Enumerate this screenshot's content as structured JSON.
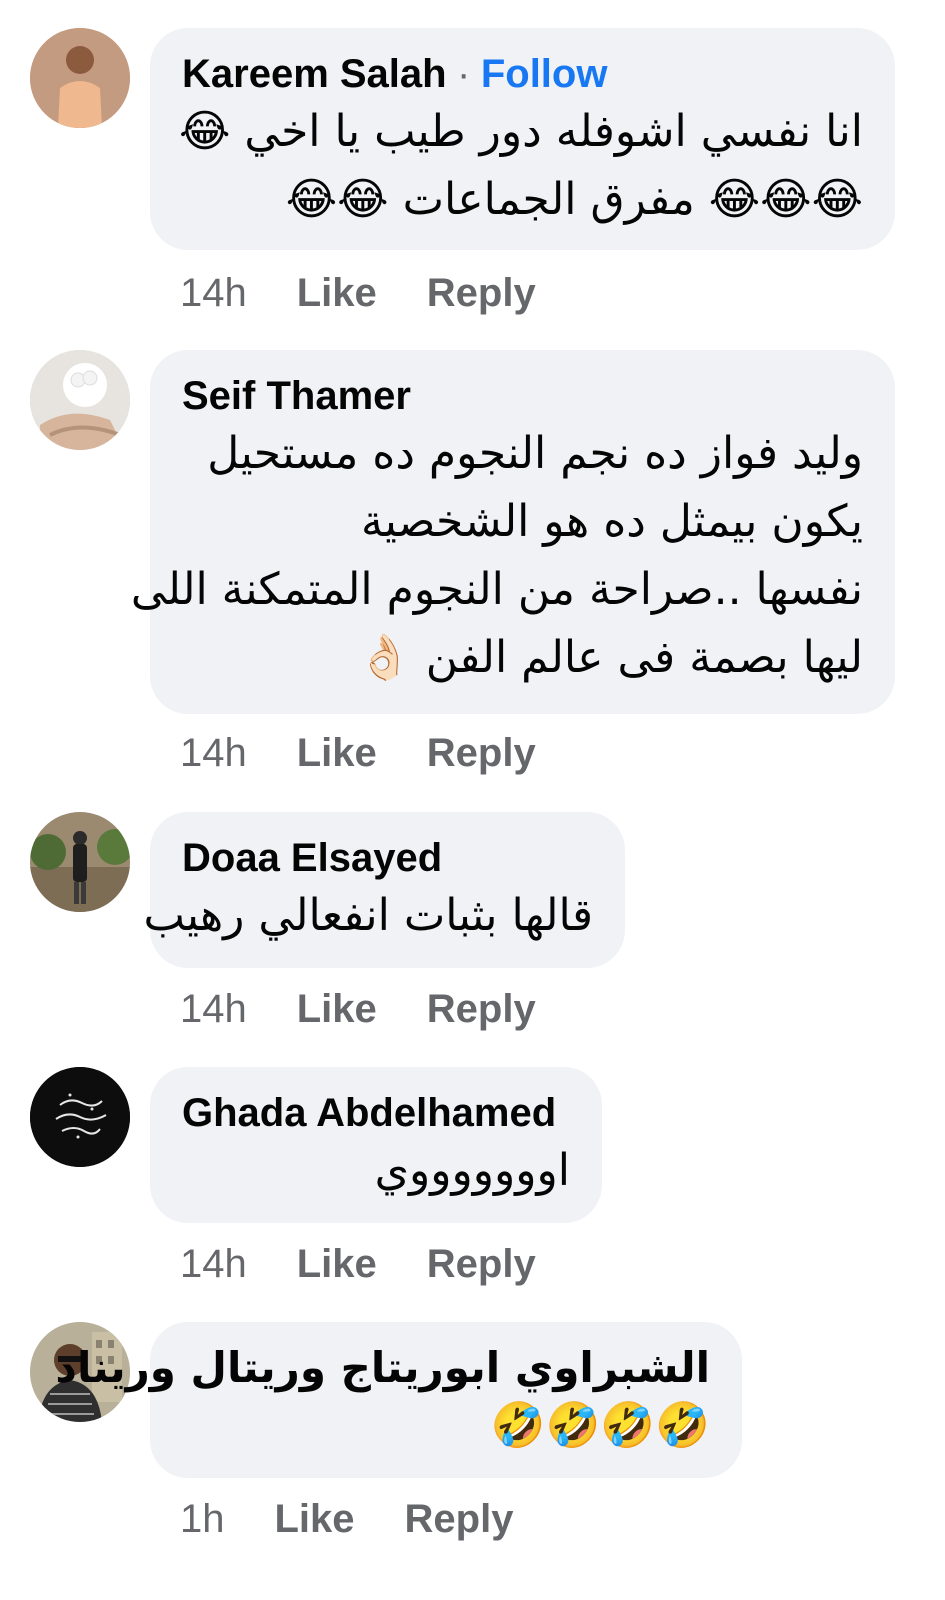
{
  "comments": [
    {
      "author": "Kareem Salah",
      "follow_sep": "·",
      "follow_label": "Follow",
      "lines": [
        "انا نفسي اشوفله دور طيب يا اخي 😂",
        "😂😂😂 مفرق الجماعات 😂😂"
      ],
      "time": "14h",
      "like": "Like",
      "reply": "Reply"
    },
    {
      "author": "Seif Thamer",
      "lines": [
        "وليد فواز ده نجم النجوم ده مستحيل",
        "يكون بيمثل ده هو الشخصية",
        "نفسها ..صراحة من النجوم المتمكنة اللى",
        "ليها بصمة فى عالم الفن 👌🏻"
      ],
      "time": "14h",
      "like": "Like",
      "reply": "Reply"
    },
    {
      "author": "Doaa Elsayed",
      "lines": [
        "قالها بثبات انفعالي رهيب"
      ],
      "time": "14h",
      "like": "Like",
      "reply": "Reply"
    },
    {
      "author": "Ghada Abdelhamed",
      "lines": [
        "اوووووووي"
      ],
      "time": "14h",
      "like": "Like",
      "reply": "Reply"
    },
    {
      "author": "الشبراوي ابوريتاج وريتال وريناد",
      "lines": [
        "🤣🤣🤣🤣"
      ],
      "time": "1h",
      "like": "Like",
      "reply": "Reply"
    }
  ],
  "colors": {
    "bubble": "#f0f2f5",
    "name": "#050505",
    "meta": "#65676b",
    "follow": "#1877f2"
  },
  "icons": {
    "emoji_laugh": "face-with-tears-of-joy-icon",
    "emoji_rofl": "rolling-on-floor-laughing-icon",
    "emoji_ok": "ok-hand-icon"
  }
}
